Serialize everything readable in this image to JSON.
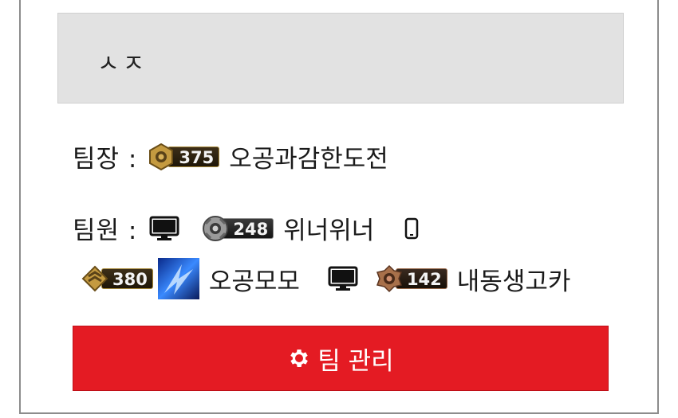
{
  "input": {
    "value": "ㅅㅈ"
  },
  "leader": {
    "label": "팀장 :",
    "badge_number": "375",
    "name": "오공과감한도전",
    "tier_color": "#b58a36"
  },
  "members": {
    "label": "팀원 :",
    "items": [
      {
        "device": "desktop-icon",
        "badge_number": "248",
        "tier_color": "#8e8e8e",
        "name": "위너위너"
      },
      {
        "device": "mobile-icon",
        "badge_number": "380",
        "tier_color": "#b58a36",
        "name": "오공모모",
        "has_avatar": true
      },
      {
        "device": "desktop-icon",
        "badge_number": "142",
        "tier_color": "#a86a4a",
        "name": "내동생고카"
      }
    ]
  },
  "manage_button": {
    "label": "팀 관리",
    "icon": "gear-icon",
    "color": "#e41b23"
  }
}
